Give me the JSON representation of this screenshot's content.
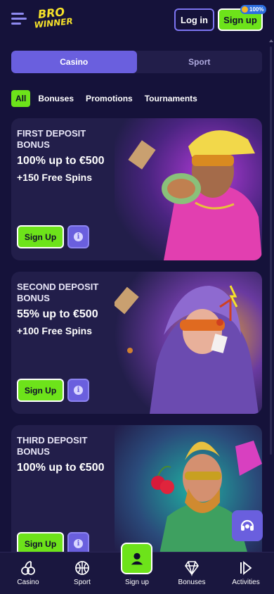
{
  "header": {
    "logo_line1": "BRO",
    "logo_line2": "WINNER",
    "login_label": "Log in",
    "signup_label": "Sign up",
    "badge_text": "100%"
  },
  "segments": [
    {
      "label": "Casino",
      "active": true
    },
    {
      "label": "Sport",
      "active": false
    }
  ],
  "filters": [
    {
      "label": "All",
      "active": true
    },
    {
      "label": "Bonuses"
    },
    {
      "label": "Promotions"
    },
    {
      "label": "Tournaments"
    }
  ],
  "cards": [
    {
      "title": "First Deposit Bonus",
      "amount": "100% up to €500",
      "spins": "+150 Free Spins",
      "cta": "Sign Up"
    },
    {
      "title": "Second Deposit Bonus",
      "amount": "55% up to €500",
      "spins": "+100 Free Spins",
      "cta": "Sign Up"
    },
    {
      "title": "Third Deposit Bonus",
      "amount": "100% up to €500",
      "spins": "",
      "cta": "Sign Up"
    }
  ],
  "bottom_nav": [
    {
      "label": "Casino",
      "icon": "cherries-icon"
    },
    {
      "label": "Sport",
      "icon": "basketball-icon"
    },
    {
      "label": "Sign up",
      "icon": "user-icon"
    },
    {
      "label": "Bonuses",
      "icon": "diamond-icon"
    },
    {
      "label": "Activities",
      "icon": "skip-icon"
    }
  ],
  "colors": {
    "background": "#15123a",
    "accent_green": "#6de31a",
    "accent_purple": "#6a5fde",
    "logo_yellow": "#f5e12a"
  }
}
